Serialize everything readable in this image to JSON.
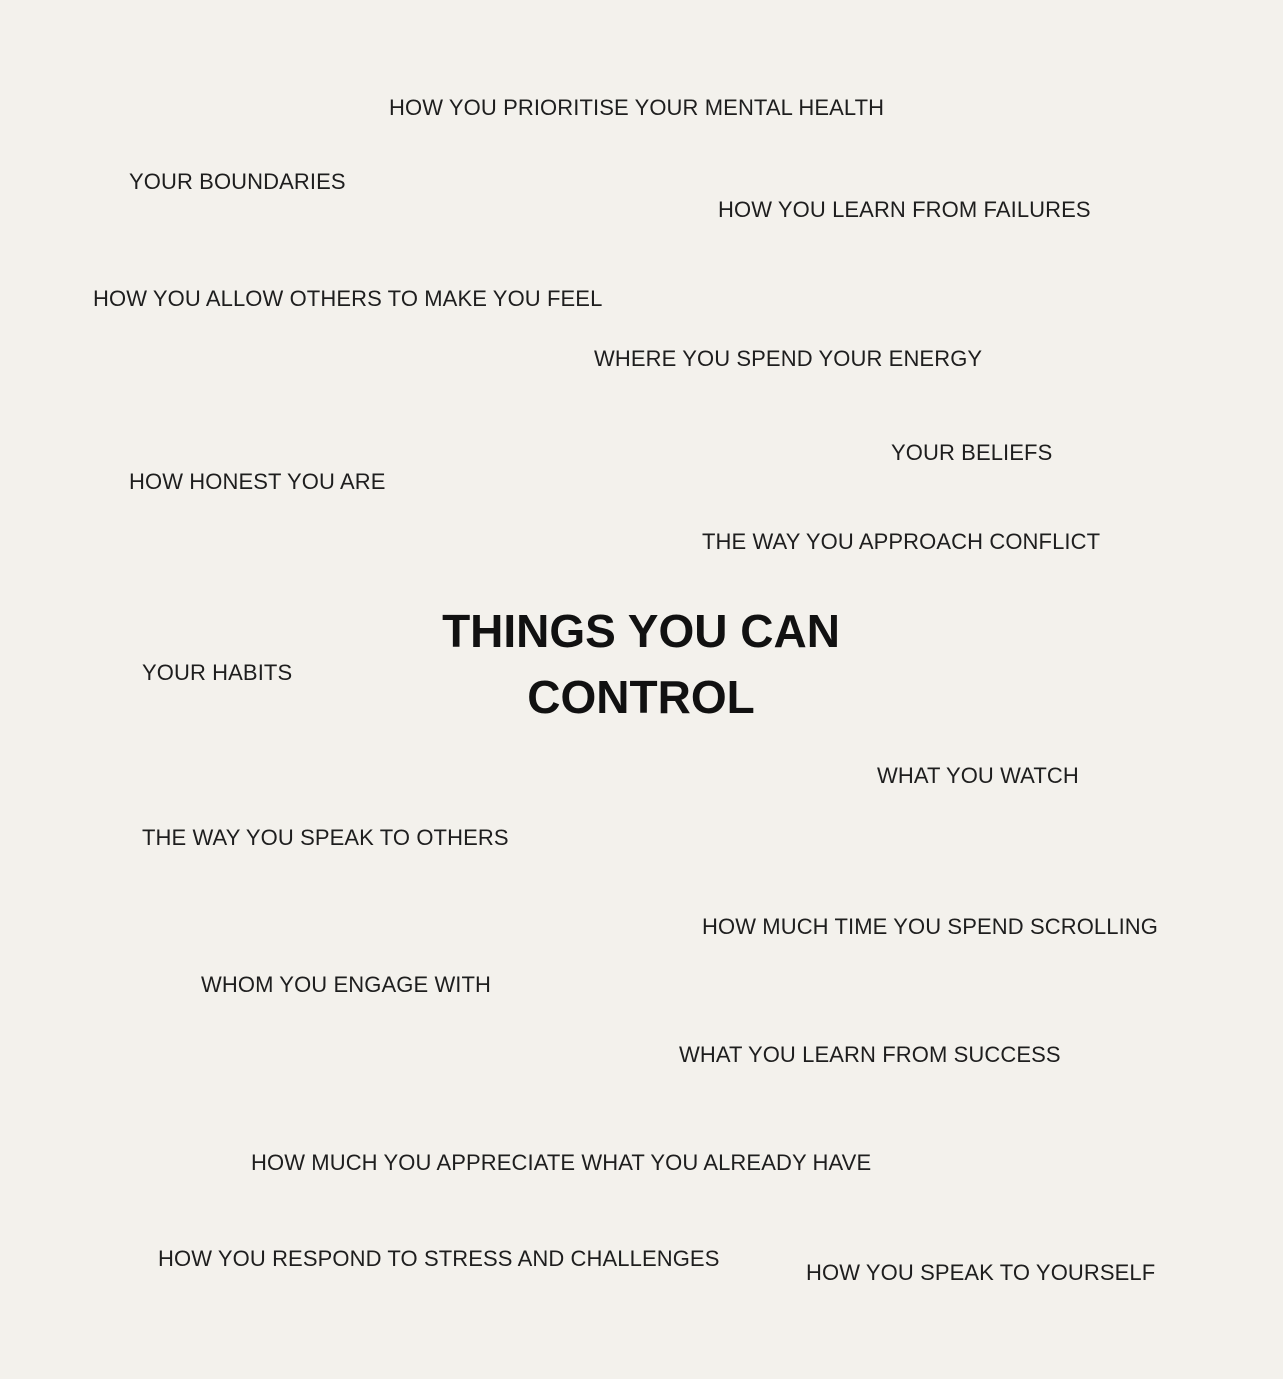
{
  "title": {
    "line1": "THINGS YOU CAN",
    "line2": "CONTROL"
  },
  "items": {
    "mental_health": "HOW YOU PRIORITISE YOUR MENTAL HEALTH",
    "boundaries": "YOUR BOUNDARIES",
    "failures": "HOW YOU LEARN FROM FAILURES",
    "allow_others": "HOW YOU ALLOW OTHERS TO MAKE YOU FEEL",
    "energy": "WHERE YOU SPEND YOUR ENERGY",
    "beliefs": "YOUR BELIEFS",
    "honest": "HOW HONEST YOU ARE",
    "conflict": "THE WAY YOU APPROACH CONFLICT",
    "habits": "YOUR HABITS",
    "watch": "WHAT YOU WATCH",
    "speak_others": "THE WAY YOU SPEAK TO OTHERS",
    "scrolling": "HOW MUCH TIME YOU SPEND SCROLLING",
    "engage": "WHOM YOU ENGAGE WITH",
    "success": "WHAT YOU LEARN FROM SUCCESS",
    "appreciate": "HOW MUCH YOU APPRECIATE WHAT YOU ALREADY HAVE",
    "stress": "HOW YOU RESPOND TO STRESS AND CHALLENGES",
    "yourself": "HOW YOU SPEAK TO YOURSELF"
  }
}
